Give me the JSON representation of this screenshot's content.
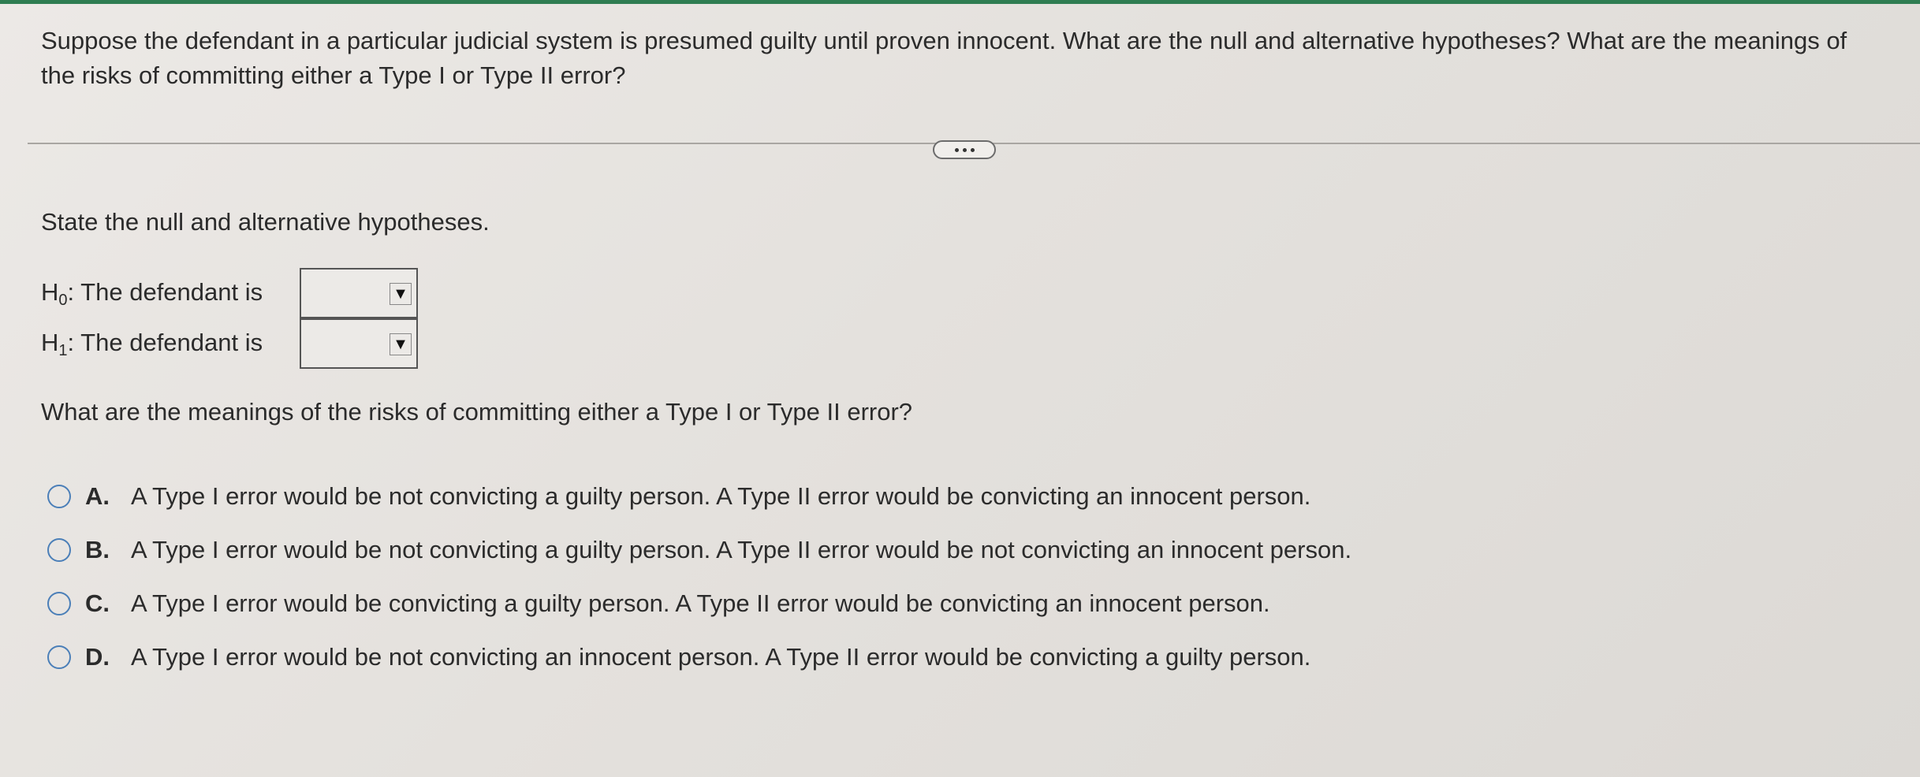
{
  "question": {
    "text": "Suppose the defendant in a particular judicial system is presumed guilty until proven innocent. What are the null and alternative hypotheses? What are the meanings of the risks of committing either a Type I or Type II error?"
  },
  "more_button": {
    "icon": "ellipsis-icon"
  },
  "hypotheses": {
    "prompt": "State the null and alternative hypotheses.",
    "h0": {
      "symbol": "H",
      "subscript": "0",
      "label": ": The defendant is",
      "selected": ""
    },
    "h1": {
      "symbol": "H",
      "subscript": "1",
      "label": ": The defendant is",
      "selected": ""
    },
    "dropdown_arrow": "▼"
  },
  "errors": {
    "prompt": "What are the meanings of the risks of committing either a Type I or Type II error?",
    "options": [
      {
        "letter": "A.",
        "text": "A Type I error would be not convicting a guilty person. A Type II error would be convicting an innocent person."
      },
      {
        "letter": "B.",
        "text": "A Type I error would be not convicting a guilty person. A Type II error would be not convicting an innocent person."
      },
      {
        "letter": "C.",
        "text": "A Type I error would be convicting a guilty person. A Type II error would be convicting an innocent person."
      },
      {
        "letter": "D.",
        "text": "A Type I error would be not convicting an innocent person. A Type II error would be convicting a guilty person."
      }
    ]
  },
  "colors": {
    "accent": "#2f7d52",
    "radio_border": "#4b7fb8"
  }
}
